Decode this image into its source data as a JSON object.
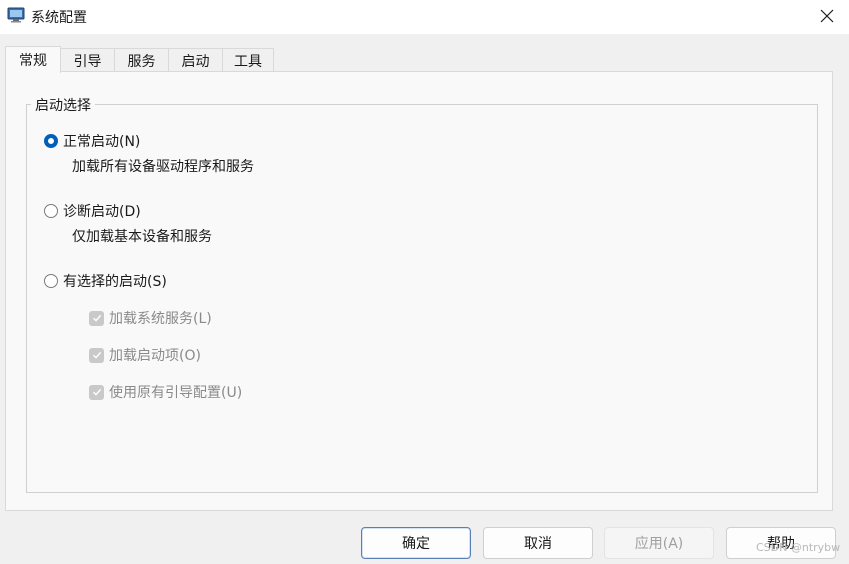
{
  "window": {
    "title": "系统配置",
    "app_icon": "msconfig-icon",
    "close_icon": "close-icon"
  },
  "tabs": [
    {
      "label": "常规",
      "active": true
    },
    {
      "label": "引导",
      "active": false
    },
    {
      "label": "服务",
      "active": false
    },
    {
      "label": "启动",
      "active": false
    },
    {
      "label": "工具",
      "active": false
    }
  ],
  "startup_group": {
    "legend": "启动选择",
    "normal": {
      "label": "正常启动(N)",
      "description": "加载所有设备驱动程序和服务",
      "selected": true
    },
    "diagnostic": {
      "label": "诊断启动(D)",
      "description": "仅加载基本设备和服务",
      "selected": false
    },
    "selective": {
      "label": "有选择的启动(S)",
      "selected": false,
      "options": [
        {
          "label": "加载系统服务(L)",
          "checked": true,
          "enabled": false
        },
        {
          "label": "加载启动项(O)",
          "checked": true,
          "enabled": false
        },
        {
          "label": "使用原有引导配置(U)",
          "checked": true,
          "enabled": false
        }
      ]
    }
  },
  "buttons": {
    "ok": "确定",
    "cancel": "取消",
    "apply": "应用(A)",
    "help": "帮助"
  },
  "watermark": "CSDN @ntrybw",
  "colors": {
    "accent": "#005fb8",
    "client_bg": "#f0f0f0",
    "panel_bg": "#f9f9f9"
  }
}
